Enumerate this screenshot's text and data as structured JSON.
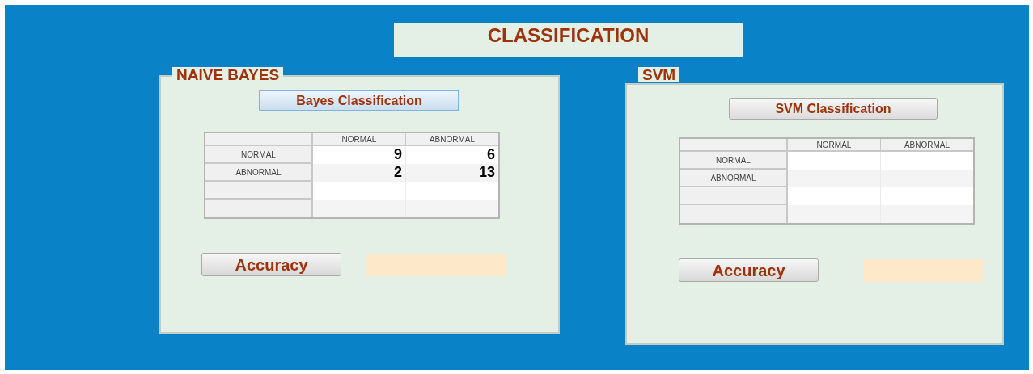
{
  "title": "CLASSIFICATION",
  "panels": [
    {
      "legend": "NAIVE BAYES",
      "button": {
        "label": "Bayes Classification",
        "focused": true
      },
      "table": {
        "columns": [
          "NORMAL",
          "ABNORMAL"
        ],
        "rows": [
          {
            "header": "NORMAL",
            "values": [
              "9",
              "6"
            ]
          },
          {
            "header": "ABNORMAL",
            "values": [
              "2",
              "13"
            ]
          }
        ]
      },
      "accuracy_button": "Accuracy"
    },
    {
      "legend": "SVM",
      "button": {
        "label": "SVM Classification",
        "focused": false
      },
      "table": {
        "columns": [
          "NORMAL",
          "ABNORMAL"
        ],
        "rows": [
          {
            "header": "NORMAL",
            "values": []
          },
          {
            "header": "ABNORMAL",
            "values": []
          }
        ]
      },
      "accuracy_button": "Accuracy"
    }
  ]
}
